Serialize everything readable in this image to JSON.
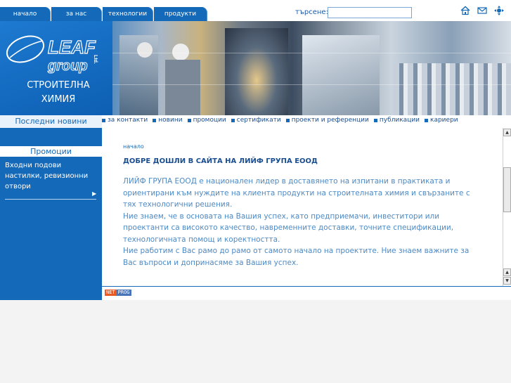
{
  "nav": {
    "tabs": [
      {
        "label": "начало"
      },
      {
        "label": "за нас"
      },
      {
        "label": "технологии"
      },
      {
        "label": "продукти"
      }
    ]
  },
  "search": {
    "label": "търсене:",
    "value": ""
  },
  "header_icons": [
    "home-icon",
    "mail-icon",
    "sitemap-icon"
  ],
  "brand": {
    "logo_text": "LEAF group",
    "logo_suffix": "Ltd.",
    "line1": "СТРОИТЕЛНА",
    "line2": "ХИМИЯ"
  },
  "news": {
    "title": "Последни новини"
  },
  "subnav": [
    {
      "label": "за контакти"
    },
    {
      "label": "новини"
    },
    {
      "label": "промоции"
    },
    {
      "label": "сертификати"
    },
    {
      "label": "проекти и референции"
    },
    {
      "label": "публикации"
    },
    {
      "label": "кариери"
    }
  ],
  "promo": {
    "title": "Промоции",
    "text": "Входни подови настилки, ревизионни отвори"
  },
  "content": {
    "breadcrumb": "начало",
    "headline": "ДОБРЕ ДОШЛИ В САЙТА НА ЛИЙФ ГРУПА ЕООД",
    "paragraphs": [
      "ЛИЙФ ГРУПА ЕООД е национален лидер в доставянето на изпитани в практиката и ориентирани към нуждите на клиента продукти на строителната химия и свързаните с тях технологични решения.",
      "Ние знаем, че в основата на Вашия успех, като предприемачи, инвеститори или проектанти са високото качество, навременните доставки, точните спецификации, технологичната помощ и коректността.",
      "Ние работим с Вас рамо до рамо от самото начало на проектите. Ние знаем важните за Вас въпроси и допринасяме за Вашия успех."
    ]
  },
  "footer": {
    "credit_a": "NET",
    "credit_b": "PROG"
  },
  "colors": {
    "primary": "#1469b8",
    "text": "#4d89c4",
    "heading": "#1a4e90"
  }
}
